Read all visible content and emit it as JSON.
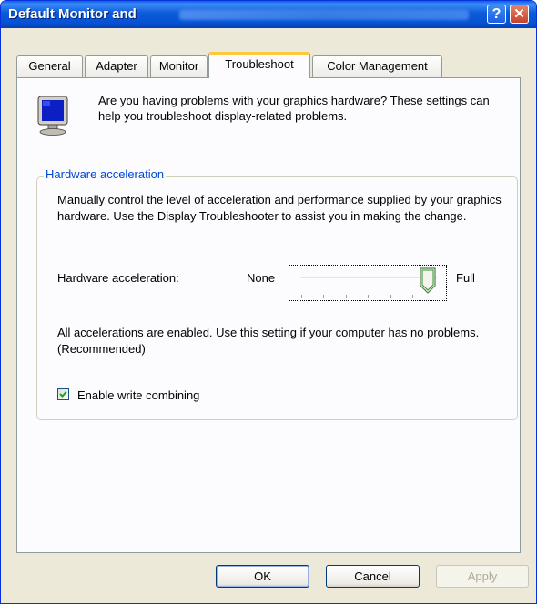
{
  "window": {
    "title": "Default Monitor and",
    "help_label": "?",
    "close_label": "✕"
  },
  "tabs": [
    {
      "label": "General",
      "active": false
    },
    {
      "label": "Adapter",
      "active": false
    },
    {
      "label": "Monitor",
      "active": false
    },
    {
      "label": "Troubleshoot",
      "active": true
    },
    {
      "label": "Color Management",
      "active": false
    }
  ],
  "intro": {
    "icon": "monitor-icon",
    "text": "Are you having problems with your graphics hardware? These settings can help you troubleshoot display-related problems."
  },
  "hardware": {
    "legend": "Hardware acceleration",
    "description": "Manually control the level of acceleration and performance supplied by your graphics hardware. Use the Display Troubleshooter to assist you in making the change.",
    "label": "Hardware acceleration:",
    "min_label": "None",
    "max_label": "Full",
    "slider_level": 1.0,
    "status_text": "All accelerations are enabled. Use this setting if your computer has no problems. (Recommended)",
    "write_combining_label": "Enable write combining",
    "write_combining_checked": true
  },
  "buttons": {
    "ok": "OK",
    "cancel": "Cancel",
    "apply": "Apply"
  },
  "colors": {
    "title_bar": "#0553d4",
    "group_legend": "#0046d5",
    "active_tab_accent": "#ffc83c",
    "dialog_bg": "#ece9d8"
  }
}
